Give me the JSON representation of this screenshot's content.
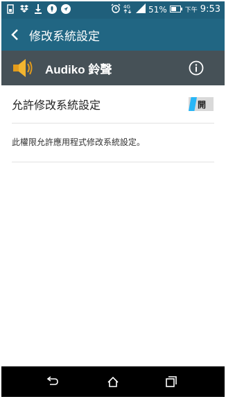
{
  "status_bar": {
    "left_icons": [
      "sim-icon",
      "dropbox-icon",
      "download-icon",
      "mic-icon",
      "navigation-icon"
    ],
    "right_icons": [
      "alarm-icon",
      "4g-icon",
      "signal-icon",
      "battery-icon"
    ],
    "battery_percent": "51%",
    "time_prefix": "下午",
    "time": "9:53"
  },
  "app_bar": {
    "title": "修改系統設定"
  },
  "app_header": {
    "app_name": "Audiko 鈴聲"
  },
  "setting": {
    "label": "允許修改系統設定",
    "toggle_state": "開",
    "description": "此權限允許應用程式修改系統設定。"
  },
  "colors": {
    "status_bar": "#1f5f7b",
    "app_bar": "#216683",
    "app_header": "#465157",
    "toggle_accent": "#29b6f6"
  }
}
